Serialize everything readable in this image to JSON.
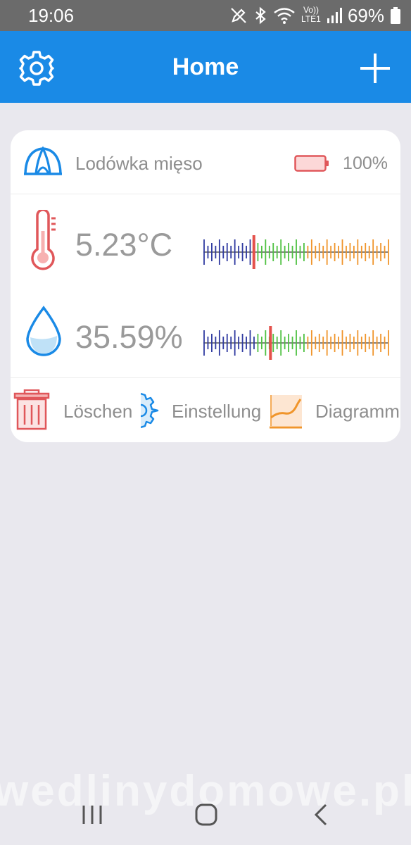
{
  "status_bar": {
    "time": "19:06",
    "battery_percent": "69%",
    "network_label_top": "Vo))",
    "network_label_bottom": "LTE1",
    "icons": [
      "pen-off-icon",
      "bluetooth-icon",
      "wifi-icon",
      "volte-icon",
      "signal-icon",
      "battery-icon"
    ]
  },
  "app_bar": {
    "title": "Home",
    "left_icon": "gear-icon",
    "right_icon": "plus-icon",
    "color": "#1a8ae6"
  },
  "device": {
    "name": "Lodówka mięso",
    "battery": "100%",
    "icon": "tent-icon"
  },
  "readings": {
    "temperature": {
      "value": "5.23°C",
      "icon": "thermometer-icon",
      "scale_level": 0.27
    },
    "humidity": {
      "value": "35.59%",
      "icon": "water-drop-icon",
      "scale_level": 0.36
    }
  },
  "actions": {
    "delete": "Löschen",
    "settings": "Einstellung",
    "chart": "Diagramm"
  },
  "watermark": "wedlinydomowe.pl",
  "colors": {
    "accent": "#1a8ae6",
    "scale_low": "#2f3aa0",
    "scale_mid": "#4fc142",
    "scale_high": "#f0952b",
    "indicator": "#e4514b",
    "text_muted": "#8e8e8e"
  }
}
